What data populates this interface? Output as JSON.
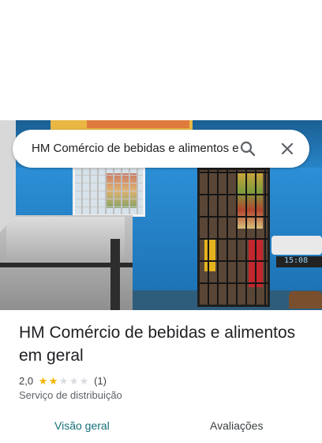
{
  "search": {
    "query": "HM Comércio de bebidas e alimentos em geral"
  },
  "place": {
    "title": "HM Comércio de bebidas e alimentos em geral",
    "rating": "2,0",
    "rating_stars": 2,
    "rating_max": 5,
    "review_count": "(1)",
    "category": "Serviço de distribuição",
    "star_color": "#f4b400",
    "star_empty_color": "#dadce0"
  },
  "tabs": [
    {
      "label": "Visão geral",
      "active": true
    },
    {
      "label": "Avaliações",
      "active": false
    }
  ],
  "photo": {
    "clock_text": "15:08"
  },
  "icons": {
    "search": "search-icon",
    "close": "close-icon"
  },
  "colors": {
    "active_tab": "#137079"
  }
}
